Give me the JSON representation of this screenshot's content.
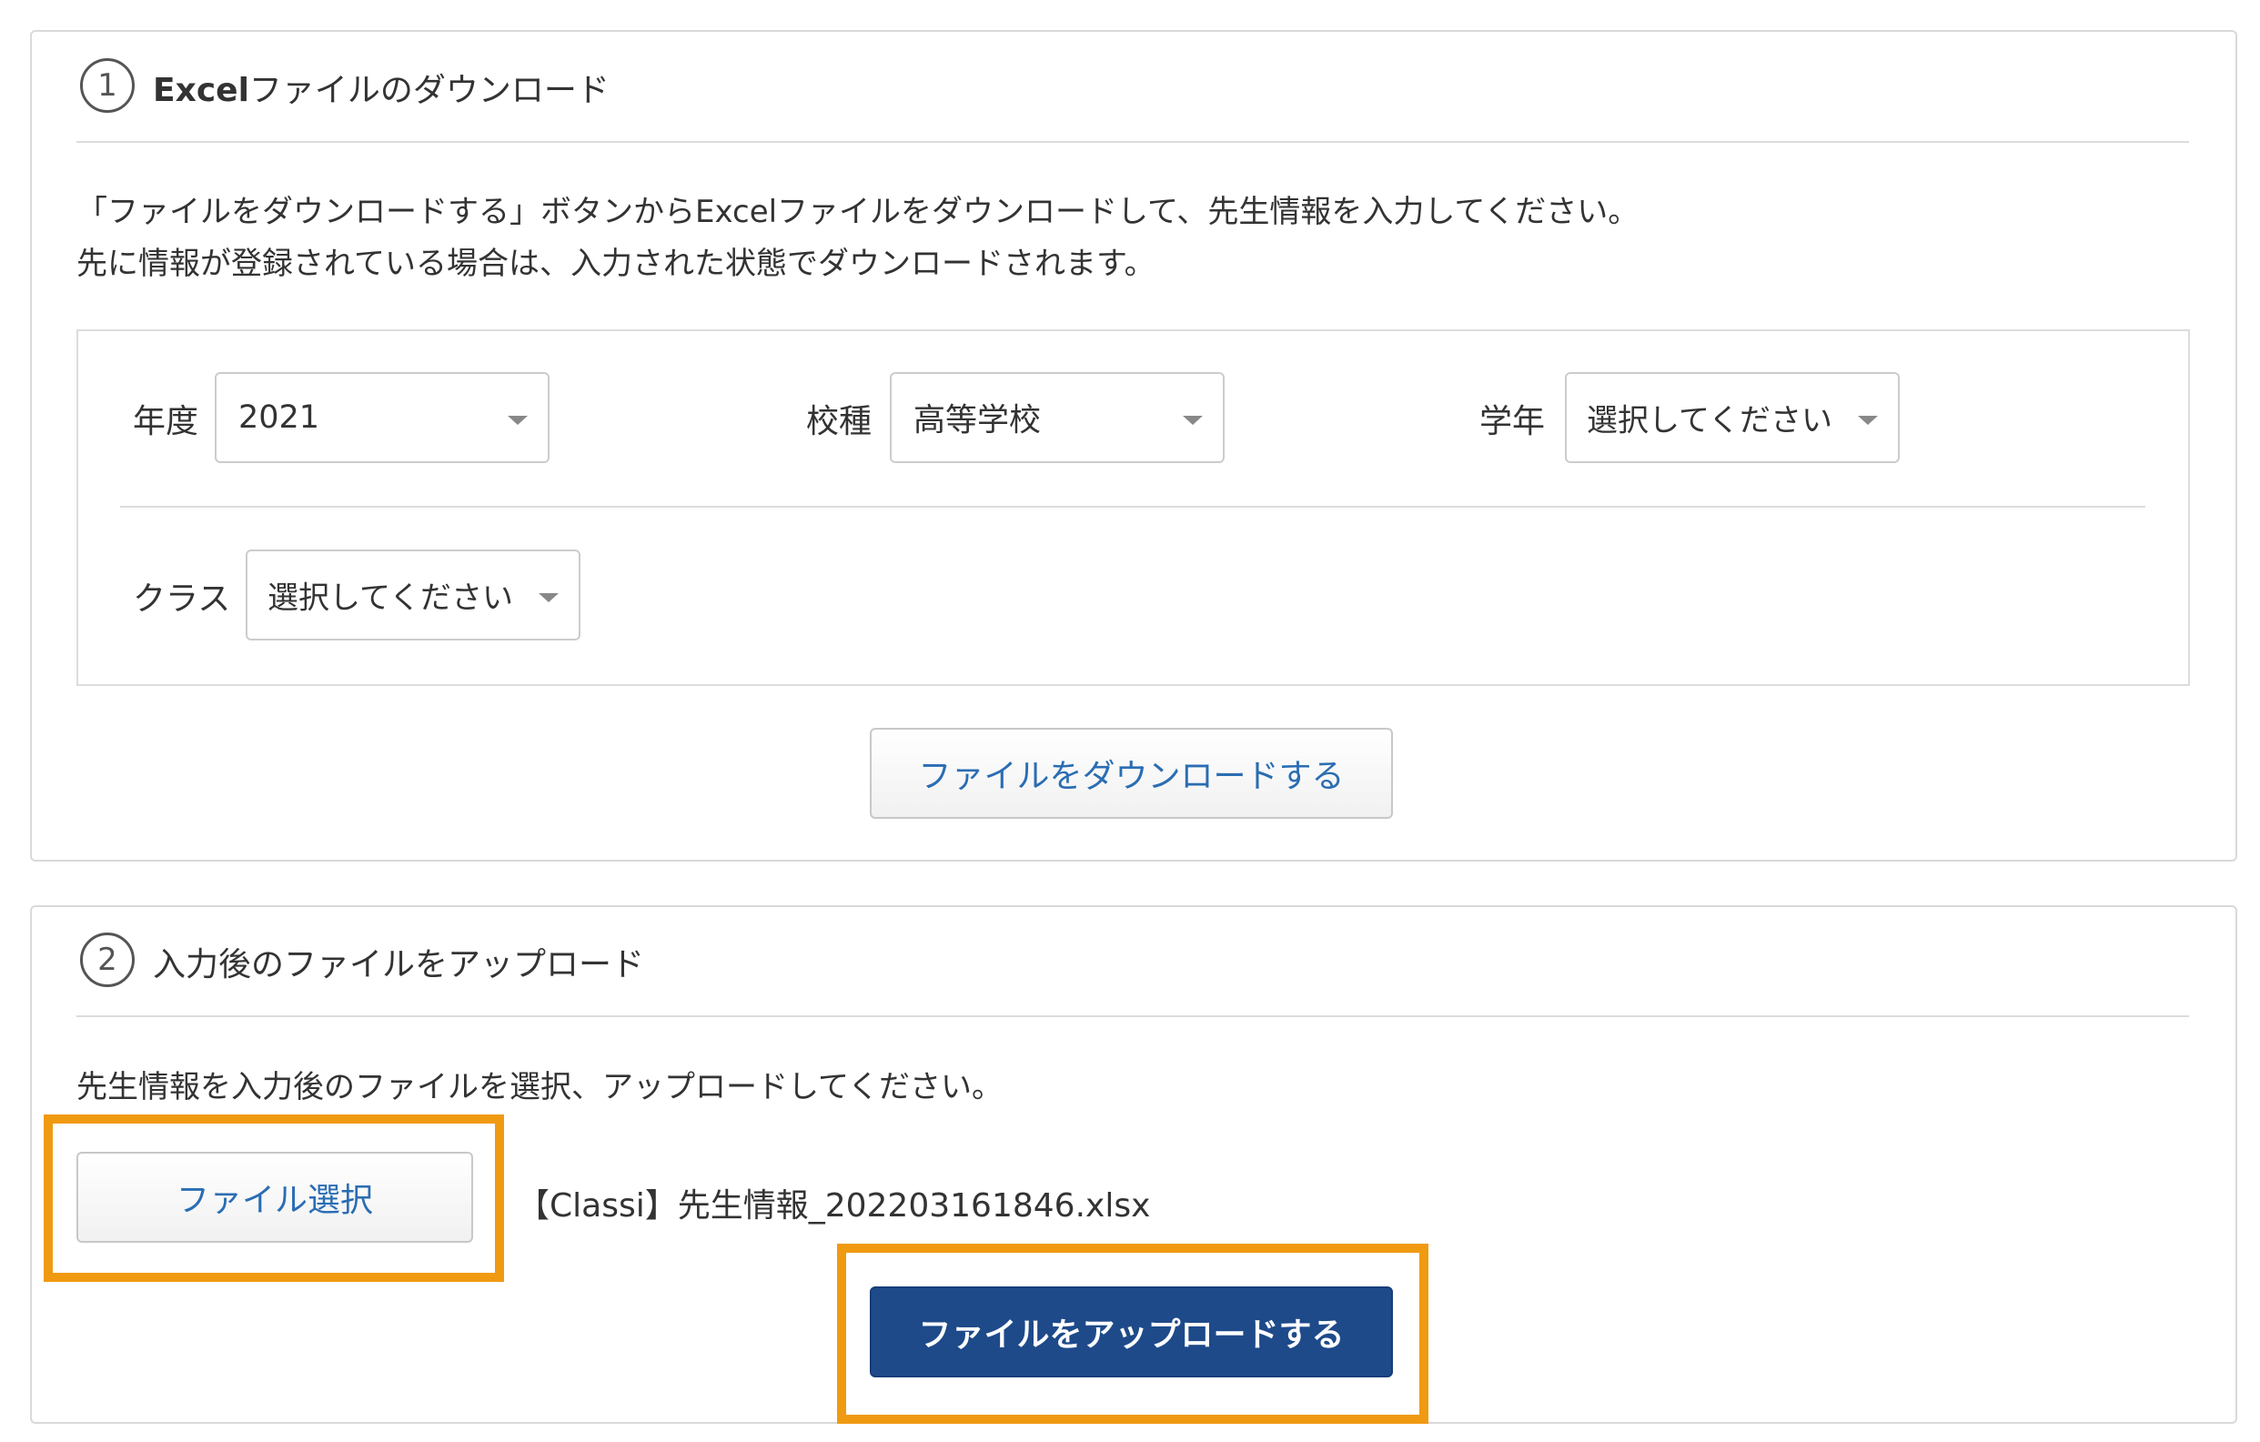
{
  "section1": {
    "step_number": "1",
    "title_bold": "Excel",
    "title_rest": "ファイルのダウンロード",
    "description_line1": "「ファイルをダウンロードする」ボタンからExcelファイルをダウンロードして、先生情報を入力してください。",
    "description_line2": "先に情報が登録されている場合は、入力された状態でダウンロードされます。",
    "filters": {
      "year": {
        "label": "年度",
        "value": "2021"
      },
      "school_type": {
        "label": "校種",
        "value": "高等学校"
      },
      "grade": {
        "label": "学年",
        "value": "選択してください"
      },
      "class": {
        "label": "クラス",
        "value": "選択してください"
      }
    },
    "download_button_label": "ファイルをダウンロードする"
  },
  "section2": {
    "step_number": "2",
    "title": "入力後のファイルをアップロード",
    "description": "先生情報を入力後のファイルを選択、アップロードしてください。",
    "file_select_button_label": "ファイル選択",
    "selected_file_name": "【Classi】先生情報_202203161846.xlsx",
    "upload_button_label": "ファイルをアップロードする"
  },
  "colors": {
    "highlight": "#f09a12",
    "primary_button": "#1e4a8a",
    "link_text": "#2a6db3"
  }
}
